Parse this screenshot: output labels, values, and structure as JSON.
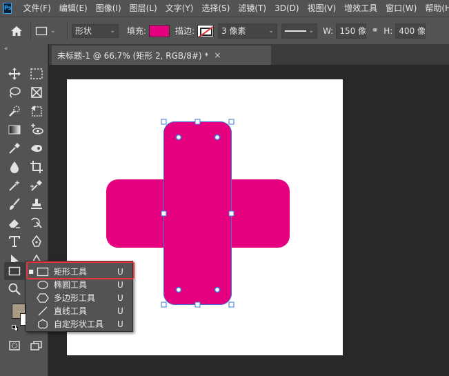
{
  "app": {
    "logo_text": "Ps"
  },
  "menu": [
    "文件(F)",
    "编辑(E)",
    "图像(I)",
    "图层(L)",
    "文字(Y)",
    "选择(S)",
    "滤镜(T)",
    "3D(D)",
    "视图(V)",
    "增效工具",
    "窗口(W)",
    "帮助(H)"
  ],
  "options": {
    "mode_value": "形状",
    "fill_label": "填充:",
    "fill_color": "#e4007f",
    "stroke_label": "描边:",
    "stroke_width_value": "3 像素",
    "width_label": "W:",
    "width_value": "150 像",
    "height_label": "H:",
    "height_value": "400 像"
  },
  "tab": {
    "title": "未标题-1 @ 66.7% (矩形 2, RGB/8#) *",
    "close": "×"
  },
  "canvas": {
    "shape_color": "#e4007f",
    "selection_color": "#3a7bd5",
    "background": "#ffffff"
  },
  "colors": {
    "foreground": "#a89a84",
    "background": "#ffffff"
  },
  "flyout": {
    "items": [
      {
        "label": "矩形工具",
        "key": "U",
        "icon": "rectangle-icon",
        "active": true
      },
      {
        "label": "椭圆工具",
        "key": "U",
        "icon": "ellipse-icon",
        "active": false
      },
      {
        "label": "多边形工具",
        "key": "U",
        "icon": "polygon-icon",
        "active": false
      },
      {
        "label": "直线工具",
        "key": "U",
        "icon": "line-icon",
        "active": false
      },
      {
        "label": "自定形状工具",
        "key": "U",
        "icon": "custom-shape-icon",
        "active": false
      }
    ]
  }
}
